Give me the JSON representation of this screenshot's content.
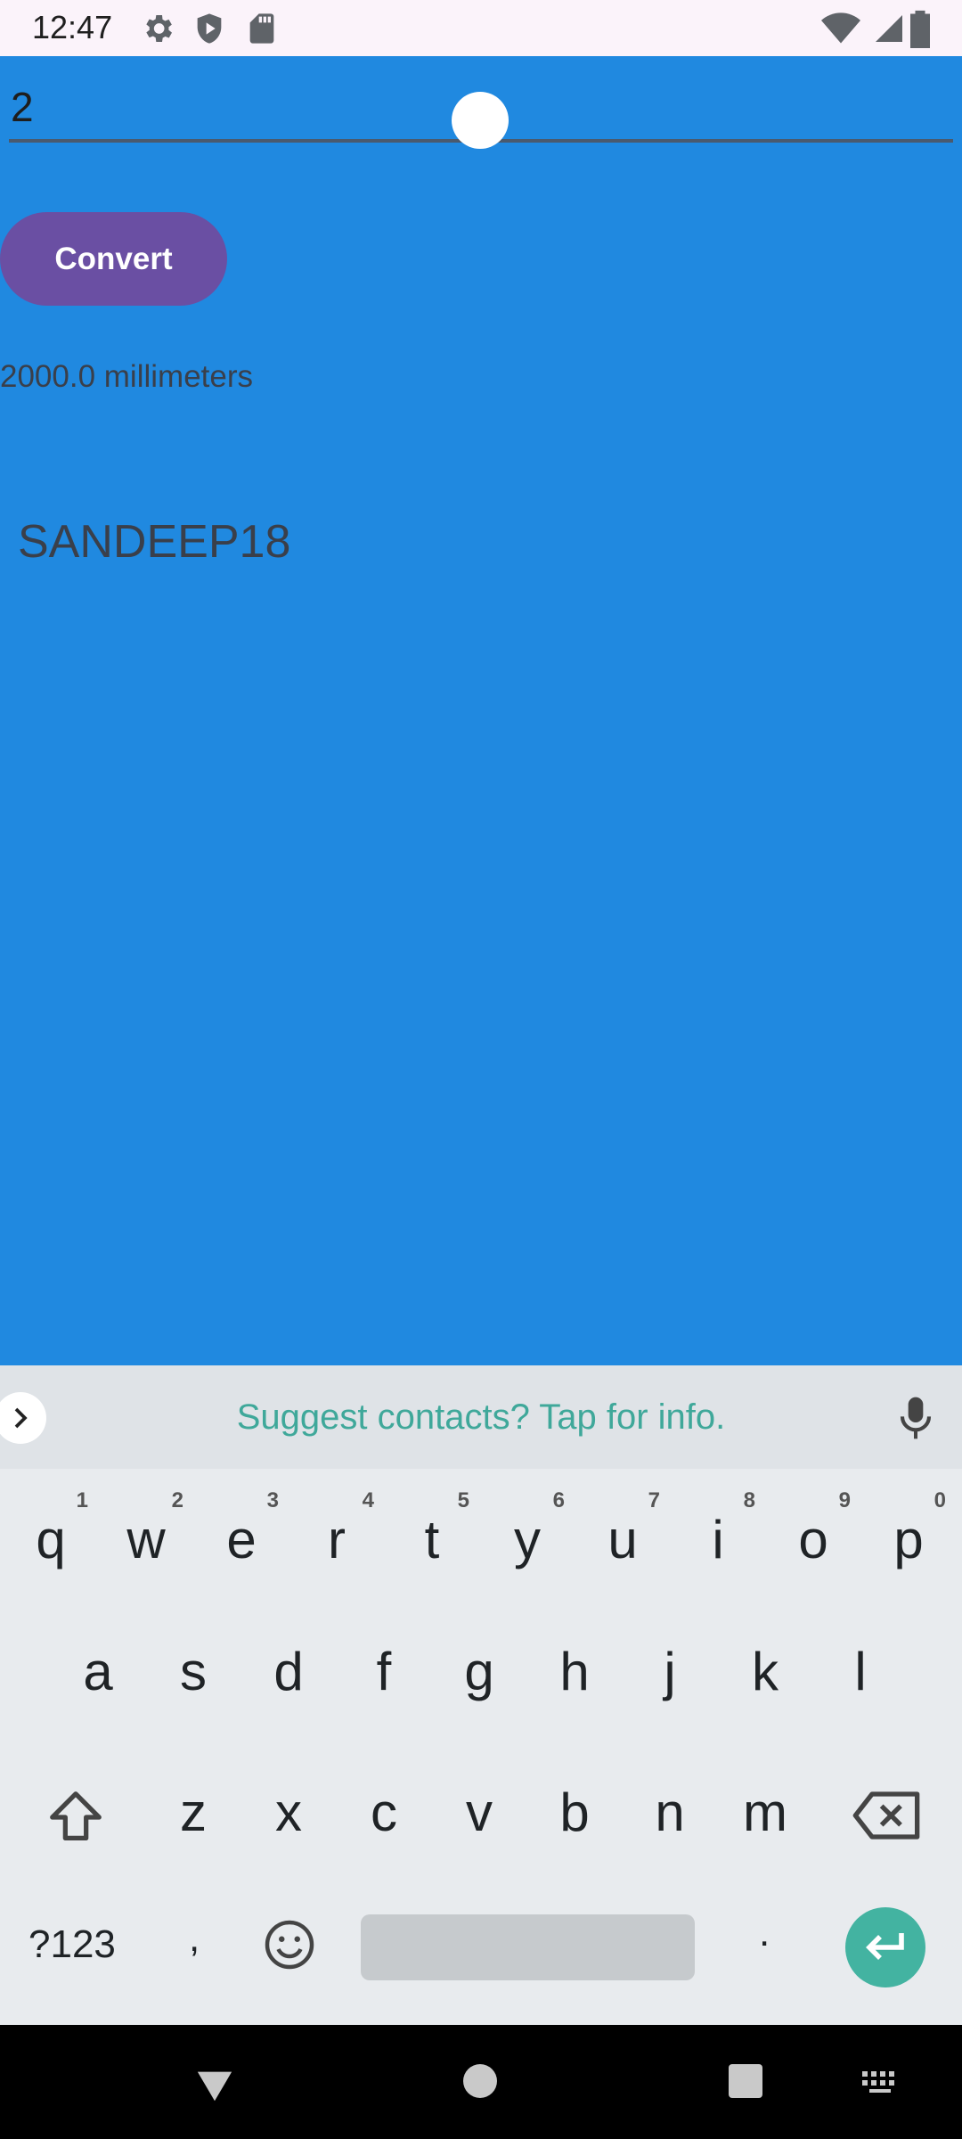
{
  "status_bar": {
    "time": "12:47",
    "left_icons": [
      "gear-icon",
      "shield-play-icon",
      "sd-card-icon"
    ],
    "right_icons": [
      "wifi-icon",
      "signal-icon",
      "battery-icon"
    ]
  },
  "app": {
    "background_color": "#2089e0",
    "input_value": "2",
    "convert_label": "Convert",
    "convert_color": "#6a4fa3",
    "result": "2000.0 millimeters",
    "name": "SANDEEP18"
  },
  "keyboard": {
    "suggestion": "Suggest contacts? Tap for info.",
    "row1": [
      {
        "k": "q",
        "h": "1"
      },
      {
        "k": "w",
        "h": "2"
      },
      {
        "k": "e",
        "h": "3"
      },
      {
        "k": "r",
        "h": "4"
      },
      {
        "k": "t",
        "h": "5"
      },
      {
        "k": "y",
        "h": "6"
      },
      {
        "k": "u",
        "h": "7"
      },
      {
        "k": "i",
        "h": "8"
      },
      {
        "k": "o",
        "h": "9"
      },
      {
        "k": "p",
        "h": "0"
      }
    ],
    "row2": [
      "a",
      "s",
      "d",
      "f",
      "g",
      "h",
      "j",
      "k",
      "l"
    ],
    "row3": [
      "z",
      "x",
      "c",
      "v",
      "b",
      "n",
      "m"
    ],
    "symbols_label": "?123",
    "comma_label": ",",
    "period_label": ".",
    "enter_color": "#43b3a1"
  }
}
